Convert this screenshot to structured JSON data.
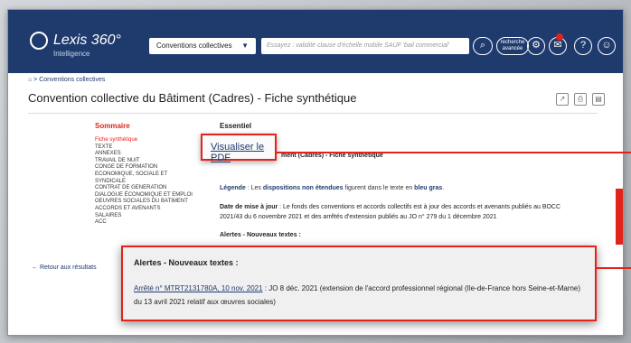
{
  "header": {
    "logo_text": "Lexis 360°",
    "logo_subtext": "Intelligence",
    "search_scope": "Conventions collectives",
    "search_placeholder": "Essayez : validité clause d'échelle mobile SAUF 'bail commercial'",
    "search_icon": "search-icon",
    "advanced_search_label": "recherche avancée",
    "icons": [
      "settings-icon",
      "notification-icon",
      "help-icon",
      "user-icon"
    ]
  },
  "breadcrumb": "⌂ > Conventions collectives",
  "page_title": "Convention collective du Bâtiment (Cadres) - Fiche synthétique",
  "title_actions": [
    "share-icon",
    "print-icon",
    "save-icon"
  ],
  "sommaire": {
    "heading": "Sommaire",
    "items": [
      "Fiche synthétique",
      "TEXTE",
      "ANNEXES",
      "TRAVAIL DE NUIT",
      "CONGE DE FORMATION ECONOMIQUE, SOCIALE ET SYNDICALE",
      "CONTRAT DE GENERATION",
      "DIALOGUE ÉCONOMIQUE ET EMPLOI",
      "OEUVRES SOCIALES DU BATIMENT",
      "ACCORDS ET AVENANTS",
      "SALAIRES",
      "ACC"
    ]
  },
  "back_link": "Retour aux résultats",
  "content": {
    "section": "Essentiel",
    "doc_title_partial": "ment (Cadres) - Fiche synthétique",
    "legend_prefix": "Légende",
    "legend_text_a": " : Les ",
    "legend_text_b": "dispositions non étendues",
    "legend_text_c": " figurent dans le texte en ",
    "legend_text_d": "bleu gras",
    "legend_end": ".",
    "update_label": "Date de mise à jour",
    "update_text": " : Le fonds des conventions et accords collectifs est à jour des accords et avenants publiés au BOCC 2021/43 du 6 novembre 2021 et des arrêtés d'extension publiés au JO n° 279 du 1 décembre 2021",
    "alerts_label": "Alertes - Nouveaux textes :"
  },
  "callout_pdf": {
    "link": "Visualiser le PDF"
  },
  "callout_alerts": {
    "heading": "Alertes - Nouveaux textes :",
    "link": "Arrêté n° MTRT2131780A, 10 nov. 2021",
    "text": " : JO 8 déc. 2021 (extension de l'accord professionnel régional (Ile-de-France hors Seine-et-Marne) du 13 avril 2021 relatif aux œuvres sociales)"
  },
  "colors": {
    "accent": "#e2231a",
    "brand": "#1f3b6e"
  }
}
